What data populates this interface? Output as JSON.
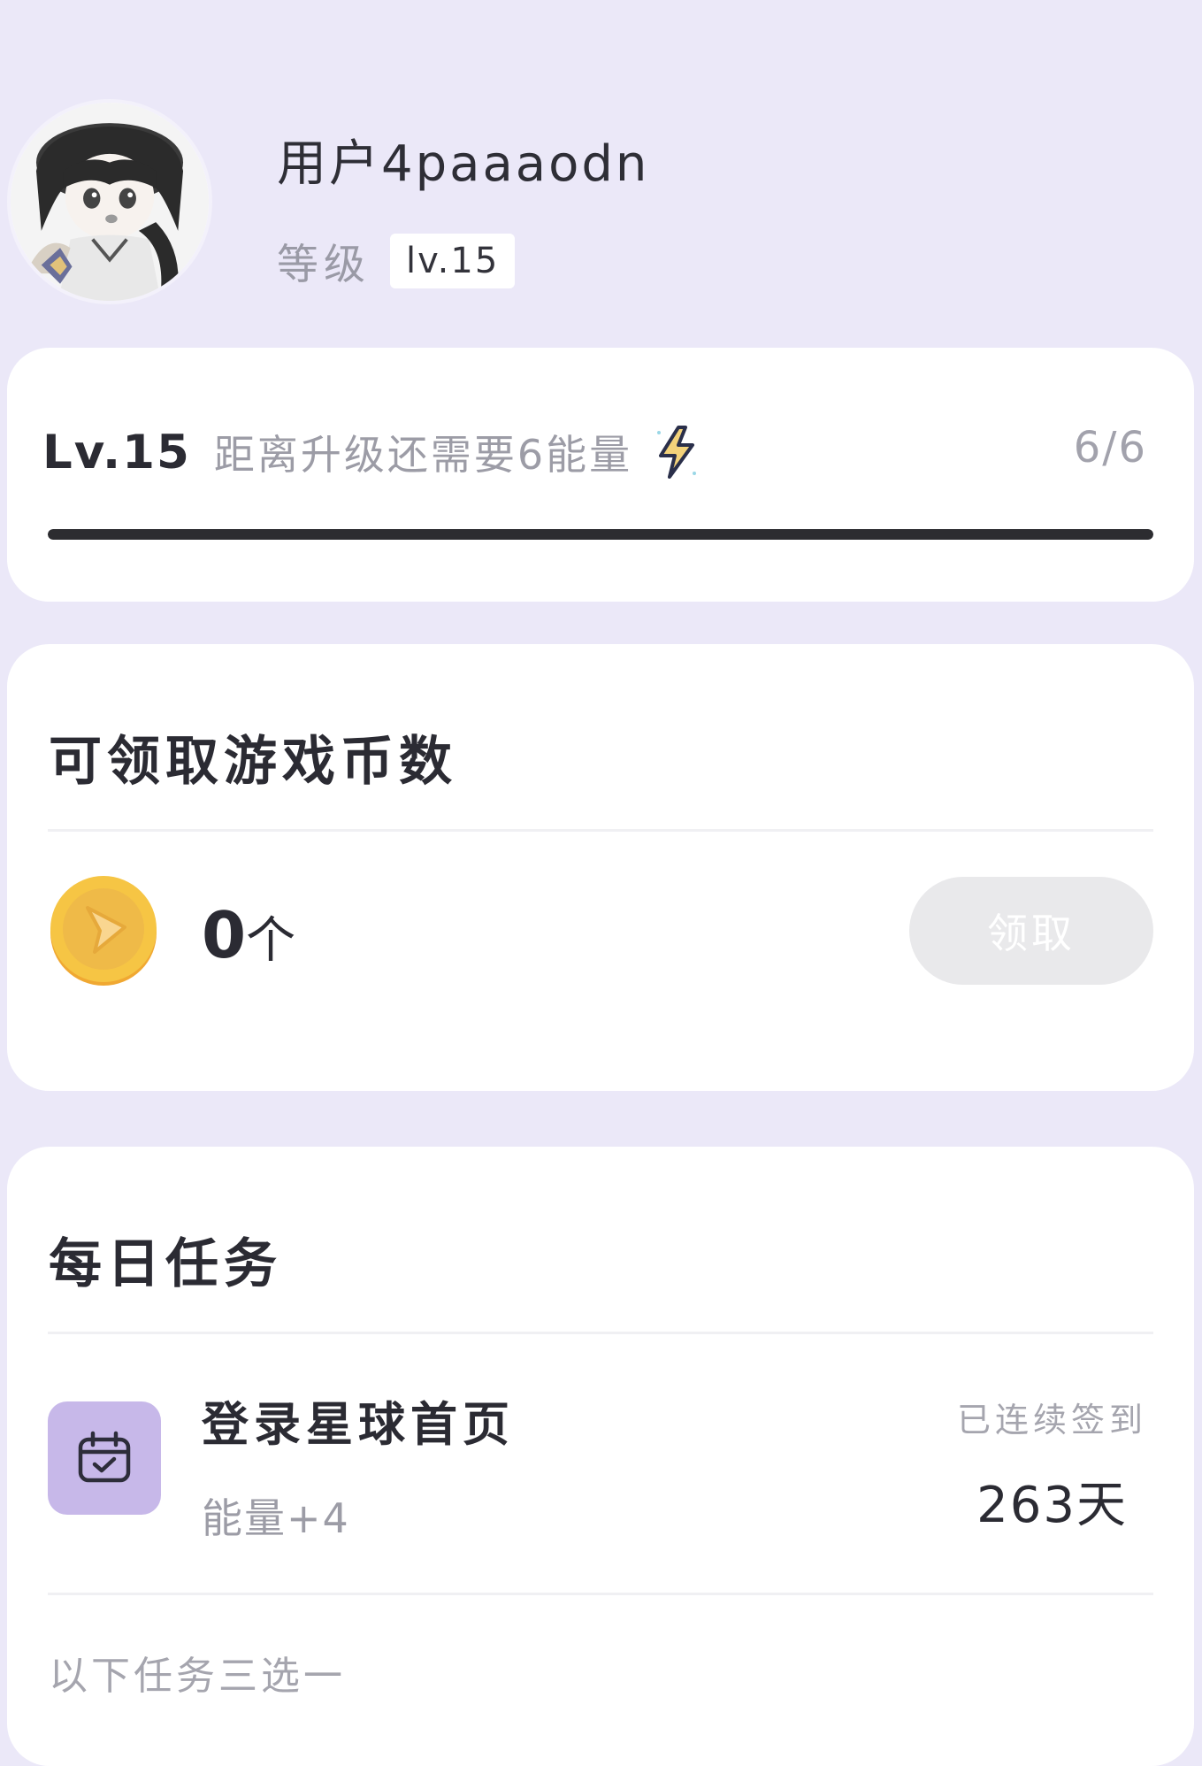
{
  "profile": {
    "username": "用户4paaaodn",
    "level_caption": "等级",
    "level_badge": "lv.15"
  },
  "level_card": {
    "level": "Lv.15",
    "hint": "距离升级还需要6能量",
    "bolt_icon": "lightning-bolt-icon",
    "progress_text": "6/6",
    "progress_fraction": 1.0
  },
  "coins_card": {
    "title": "可领取游戏币数",
    "coin_icon": "game-coin-icon",
    "count": "0",
    "unit": "个",
    "claim_label": "领取",
    "claim_enabled": false
  },
  "daily_tasks": {
    "title": "每日任务",
    "task": {
      "icon": "calendar-check-icon",
      "title": "登录星球首页",
      "reward": "能量+4",
      "streak_label": "已连续签到",
      "streak_days": "263天"
    },
    "choose_one_caption": "以下任务三选一"
  },
  "colors": {
    "background": "#ebe8f8",
    "progress_fill": "#2c2c30",
    "task_icon_bg": "#c7b8e9",
    "coin_gold": "#f0b73a"
  }
}
